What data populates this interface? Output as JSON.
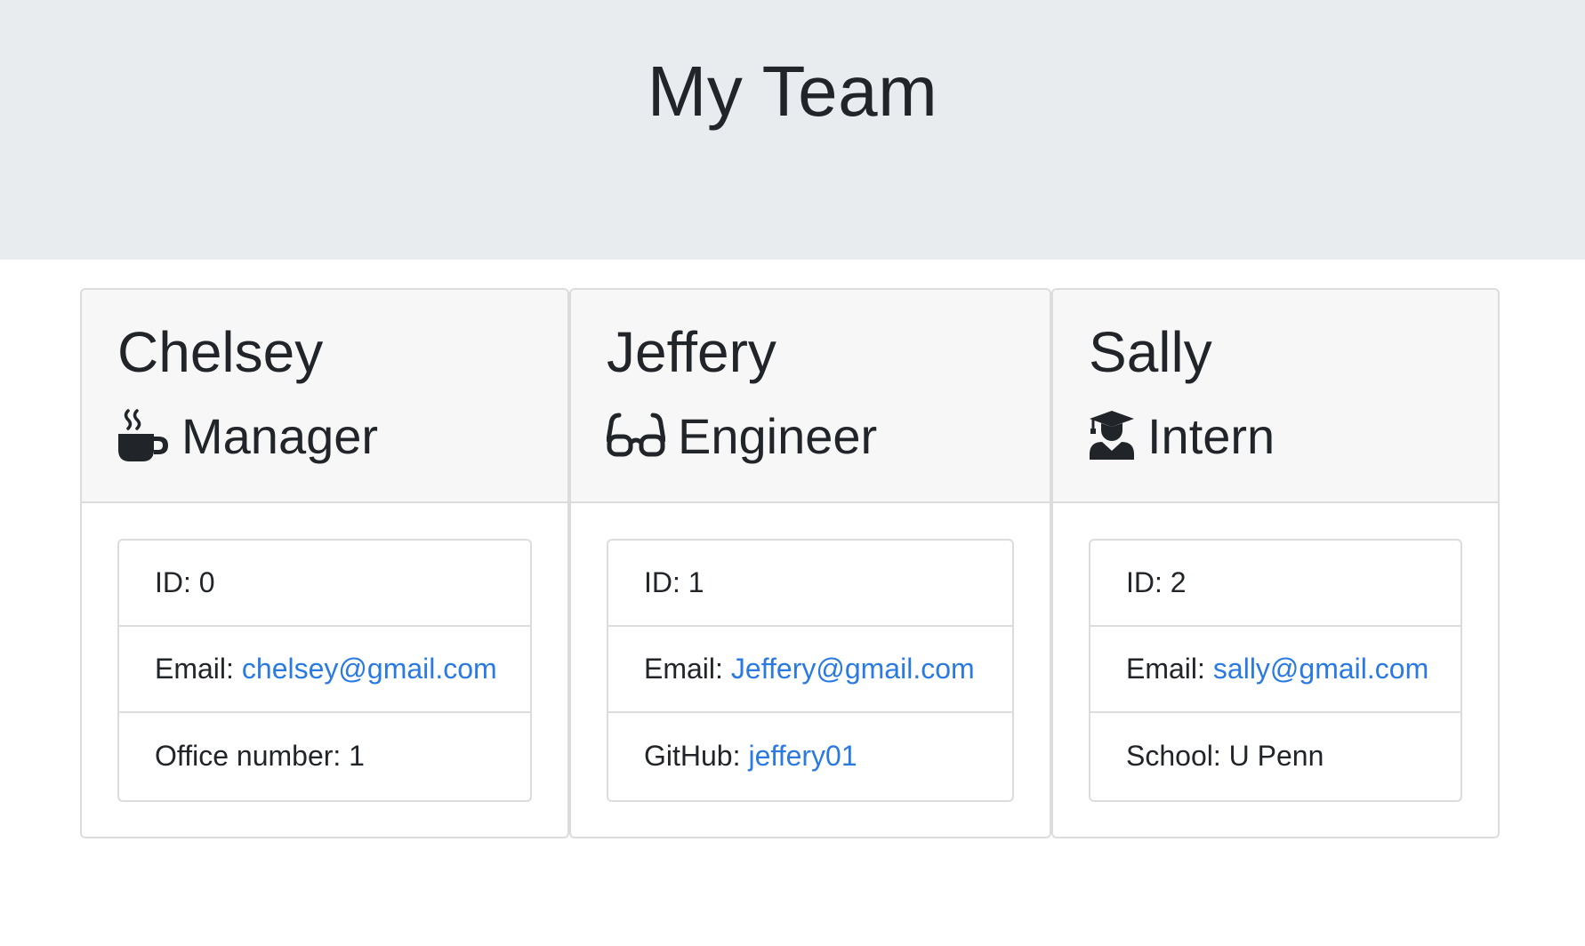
{
  "header": {
    "title": "My Team"
  },
  "team": [
    {
      "name": "Chelsey",
      "role": "Manager",
      "icon": "coffee-mug-icon",
      "id_text": "ID: 0",
      "email_label": "Email:",
      "email": "chelsey@gmail.com",
      "extra_label": "Office number: 1",
      "extra_link": ""
    },
    {
      "name": "Jeffery",
      "role": "Engineer",
      "icon": "glasses-icon",
      "id_text": "ID: 1",
      "email_label": "Email:",
      "email": "Jeffery@gmail.com",
      "extra_label": "GitHub:",
      "extra_link": "jeffery01"
    },
    {
      "name": "Sally",
      "role": "Intern",
      "icon": "graduate-icon",
      "id_text": "ID: 2",
      "email_label": "Email:",
      "email": "sally@gmail.com",
      "extra_label": "School: U Penn",
      "extra_link": ""
    }
  ],
  "colors": {
    "jumbotron_bg": "#e9ecef",
    "card_header_bg": "#f7f7f7",
    "link": "#2a7ae2",
    "text": "#212529",
    "border": "#dcdcdc"
  }
}
